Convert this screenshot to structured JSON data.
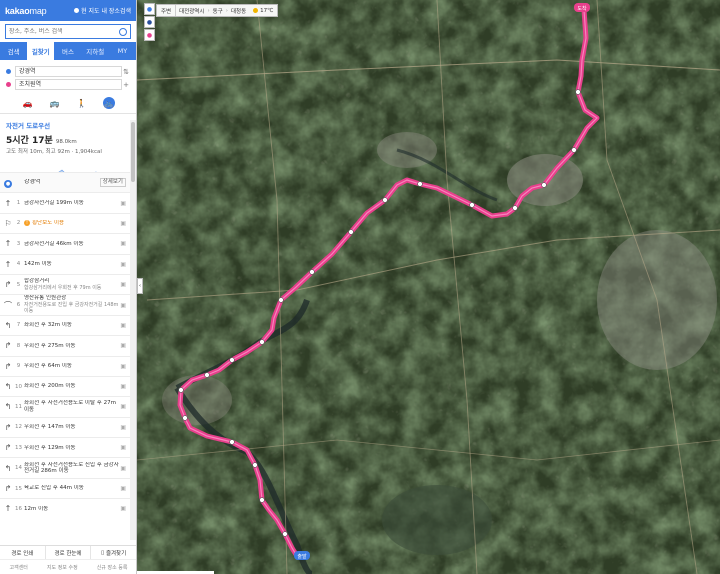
{
  "header": {
    "logo": "kakao",
    "logo_suffix": "map",
    "my_location": "현 지도 내 장소검색"
  },
  "search": {
    "placeholder": "장소, 주소, 버스 검색"
  },
  "tabs": [
    {
      "label": "검색",
      "active": false
    },
    {
      "label": "길찾기",
      "active": true
    },
    {
      "label": "버스",
      "active": false
    },
    {
      "label": "지하철",
      "active": false
    },
    {
      "label": "MY",
      "active": false
    }
  ],
  "route": {
    "origin": "강경역",
    "destination": "조치원역",
    "modes": [
      {
        "icon": "car-icon",
        "glyph": "🚗",
        "active": false
      },
      {
        "icon": "bus-icon",
        "glyph": "🚌",
        "active": false
      },
      {
        "icon": "walk-icon",
        "glyph": "🚶",
        "active": false
      },
      {
        "icon": "bicycle-icon",
        "glyph": "🚲",
        "active": true
      }
    ]
  },
  "summary": {
    "title": "자전거 도로우선",
    "time": "5시간 17분",
    "distance": "98.0km",
    "info": "고도 최저 10m, 최고 92m · 1,904kcal"
  },
  "steps": [
    {
      "type": "start",
      "text": "강경역",
      "detail": "상세보기"
    },
    {
      "num": "1",
      "glyph": "↑",
      "icon": "straight-arrow-icon",
      "text": "금강자전거길 199m 이동"
    },
    {
      "num": "2",
      "glyph": "⚐",
      "icon": "walk-icon",
      "text": "횡단보도 이용",
      "warn": true
    },
    {
      "num": "3",
      "glyph": "↑",
      "icon": "straight-arrow-icon",
      "text": "금강자전거길 46km 이동"
    },
    {
      "num": "4",
      "glyph": "↑",
      "icon": "straight-arrow-icon",
      "text": "142m 이동"
    },
    {
      "num": "5",
      "glyph": "↱",
      "icon": "right-turn-icon",
      "text": "합강삼거리",
      "sub": "합강삼거리에서 우회전 후 79m 이동"
    },
    {
      "num": "6",
      "glyph": "⌒",
      "icon": "tunnel-icon",
      "text": "영산유통 인원관광",
      "sub": "자전거전용도로 진입 후 금강자전거길 148m 이동"
    },
    {
      "num": "7",
      "glyph": "↰",
      "icon": "left-turn-icon",
      "text": "좌회전 후 32m 이동"
    },
    {
      "num": "8",
      "glyph": "↱",
      "icon": "right-turn-icon",
      "text": "우회전 후 275m 이동"
    },
    {
      "num": "9",
      "glyph": "↱",
      "icon": "right-turn-icon",
      "text": "우회전 후 64m 이동"
    },
    {
      "num": "10",
      "glyph": "↰",
      "icon": "left-turn-icon",
      "text": "좌회전 후 200m 이동"
    },
    {
      "num": "11",
      "glyph": "↰",
      "icon": "left-turn-icon",
      "text": "좌회전 후 자전거전용도로 이탈 후 27m 이동"
    },
    {
      "num": "12",
      "glyph": "↱",
      "icon": "right-turn-icon",
      "text": "우회전 후 147m 이동"
    },
    {
      "num": "13",
      "glyph": "↱",
      "icon": "right-turn-icon",
      "text": "우회전 후 129m 이동"
    },
    {
      "num": "14",
      "glyph": "↰",
      "icon": "left-turn-icon",
      "text": "좌회전 후 자전거전용도로 진입 후 금강자전거길 286m 이동"
    },
    {
      "num": "15",
      "glyph": "↱",
      "icon": "right-turn-icon",
      "text": "육교로 진입 후 44m 이동"
    },
    {
      "num": "16",
      "glyph": "↑",
      "icon": "straight-arrow-icon",
      "text": "12m 이동"
    }
  ],
  "actions": [
    {
      "label": "경로 인쇄",
      "name": "print-route-button"
    },
    {
      "label": "경로 한눈에",
      "name": "route-overview-button"
    },
    {
      "label": "즐겨찾기",
      "name": "bookmark-route-button"
    }
  ],
  "footer": [
    "고객센터",
    "지도 정보 수정",
    "신규 장소 등록"
  ],
  "map": {
    "breadcrumb_btn": "주변",
    "region": [
      "대전광역시",
      "동구",
      "대청동"
    ],
    "weather": "17℃",
    "route_color": "#e8408c",
    "start_label": "출발",
    "end_label": "도착"
  }
}
